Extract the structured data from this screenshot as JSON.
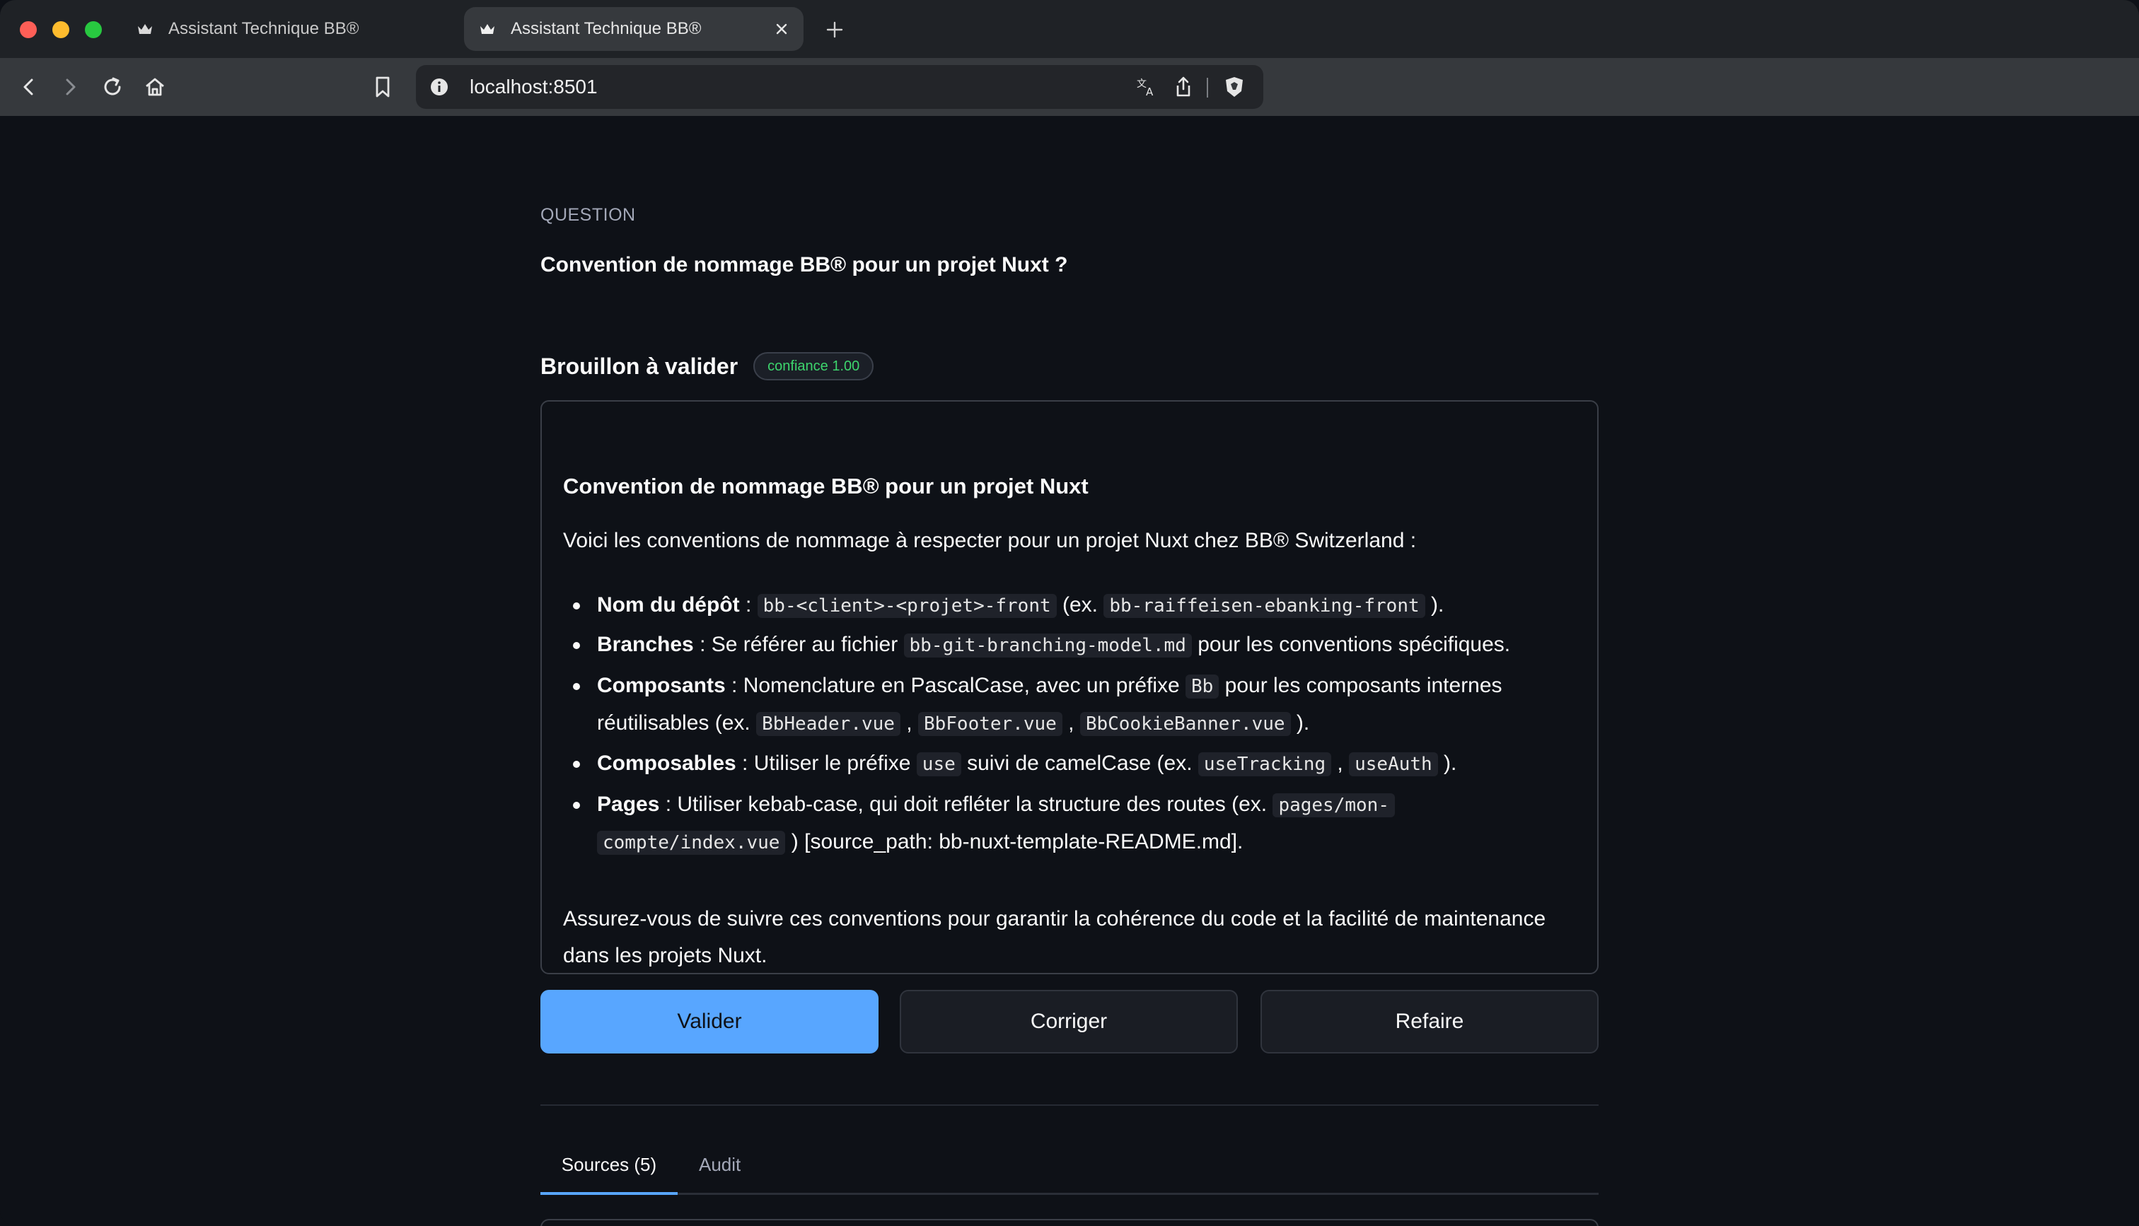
{
  "browser": {
    "tabs": [
      {
        "title": "Assistant Technique BB®",
        "active": false
      },
      {
        "title": "Assistant Technique BB®",
        "active": true
      }
    ],
    "url": "localhost:8501"
  },
  "question": {
    "label": "QUESTION",
    "text": "Convention de nommage BB® pour un projet Nuxt ?"
  },
  "draft": {
    "title": "Brouillon à valider",
    "confidence_badge": "confiance 1.00",
    "heading": "Convention de nommage BB® pour un projet Nuxt",
    "intro": "Voici les conventions de nommage à respecter pour un projet Nuxt chez BB® Switzerland :",
    "items": {
      "depot": {
        "label": "Nom du dépôt",
        "sep": " : ",
        "code1": "bb-<client>-<projet>-front",
        "mid": " (ex. ",
        "code2": "bb-raiffeisen-ebanking-front",
        "end": " )."
      },
      "branches": {
        "label": "Branches",
        "text1": " : Se référer au fichier ",
        "code1": "bb-git-branching-model.md",
        "text2": " pour les conventions spécifiques."
      },
      "composants": {
        "label": "Composants",
        "text1": " : Nomenclature en PascalCase, avec un préfixe ",
        "code1": "Bb",
        "text2": " pour les composants internes",
        "text3": "réutilisables (ex. ",
        "code2": "BbHeader.vue",
        "comma1": " , ",
        "code3": "BbFooter.vue",
        "comma2": " , ",
        "code4": "BbCookieBanner.vue",
        "end": " )."
      },
      "composables": {
        "label": "Composables",
        "text1": " : Utiliser le préfixe ",
        "code1": "use",
        "text2": " suivi de camelCase (ex. ",
        "code2": "useTracking",
        "comma": " , ",
        "code3": "useAuth",
        "end": " )."
      },
      "pages": {
        "label": "Pages",
        "text1": " : Utiliser kebab-case, qui doit refléter la structure des routes (ex. ",
        "code1a": "pages/mon-",
        "code1b": "compte/index.vue",
        "text2": " ) [source_path: bb-nuxt-template-README.md]."
      }
    },
    "outro_line1": "Assurez-vous de suivre ces conventions pour garantir la cohérence du code et la facilité de maintenance",
    "outro_line2": "dans les projets Nuxt."
  },
  "actions": {
    "validate": "Valider",
    "correct": "Corriger",
    "redo": "Refaire"
  },
  "panel_tabs": [
    "Sources (5)",
    "Audit"
  ],
  "colors": {
    "primary": "#58a6ff",
    "badge_text": "#3dd56d",
    "background": "#0e1117"
  }
}
